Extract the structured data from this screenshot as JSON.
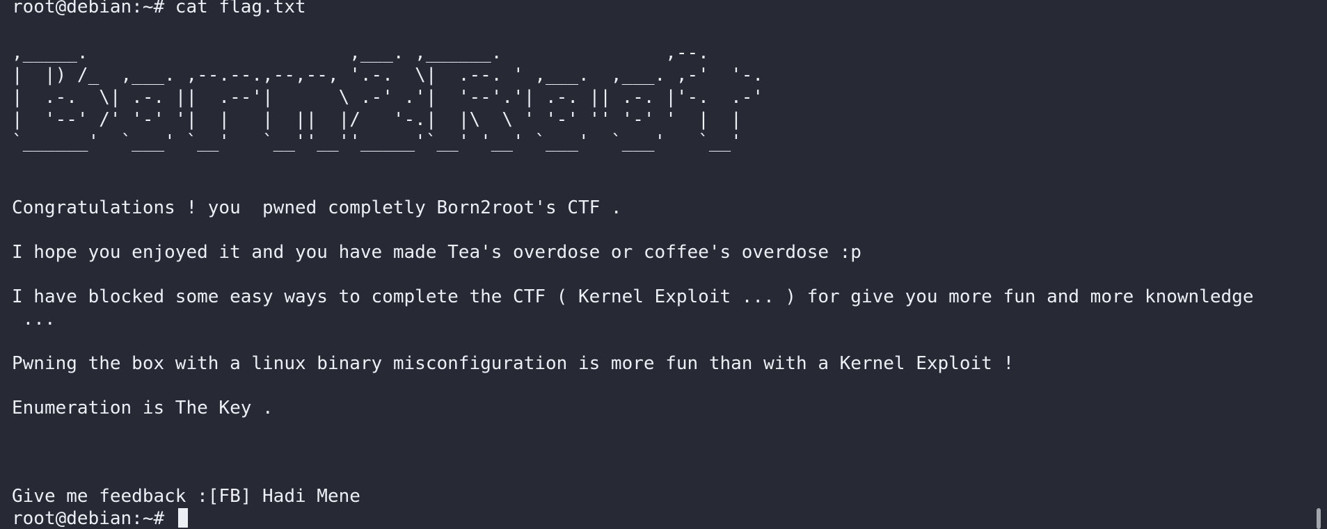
{
  "terminal": {
    "command_line": "root@debian:~# cat flag.txt",
    "ascii_art": ",_____.                        ,___. ,______.               ,--.\n|  |) /_  ,___. ,--.--.,--,--, '.-.  \\|  .--. ' ,___.  ,___. ,-'  '-.\n|  .-.  \\| .-. ||  .--'|      \\ .-' .'|  '--'.'| .-. || .-. |'-.  .-'\n|  '--' /' '-' '|  |   |  ||  |/   '-.|  |\\  \\ ' '-' '' '-' '  |  |\n`______'  `___' `__'   `__''__''_____'`__' '__' `___'  `___'   `__'",
    "lines": [
      "Congratulations ! you  pwned completly Born2root's CTF .",
      "I hope you enjoyed it and you have made Tea's overdose or coffee's overdose :p",
      "I have blocked some easy ways to complete the CTF ( Kernel Exploit ... ) for give you more fun and more knownledge",
      " ...",
      "Pwning the box with a linux binary misconfiguration is more fun than with a Kernel Exploit !",
      "Enumeration is The Key .",
      "Give me feedback :[FB] Hadi Mene"
    ],
    "prompt": "root@debian:~# "
  },
  "colors": {
    "background": "#272a35",
    "foreground": "#eceff4",
    "scrollbar": "#a3a6ad"
  }
}
